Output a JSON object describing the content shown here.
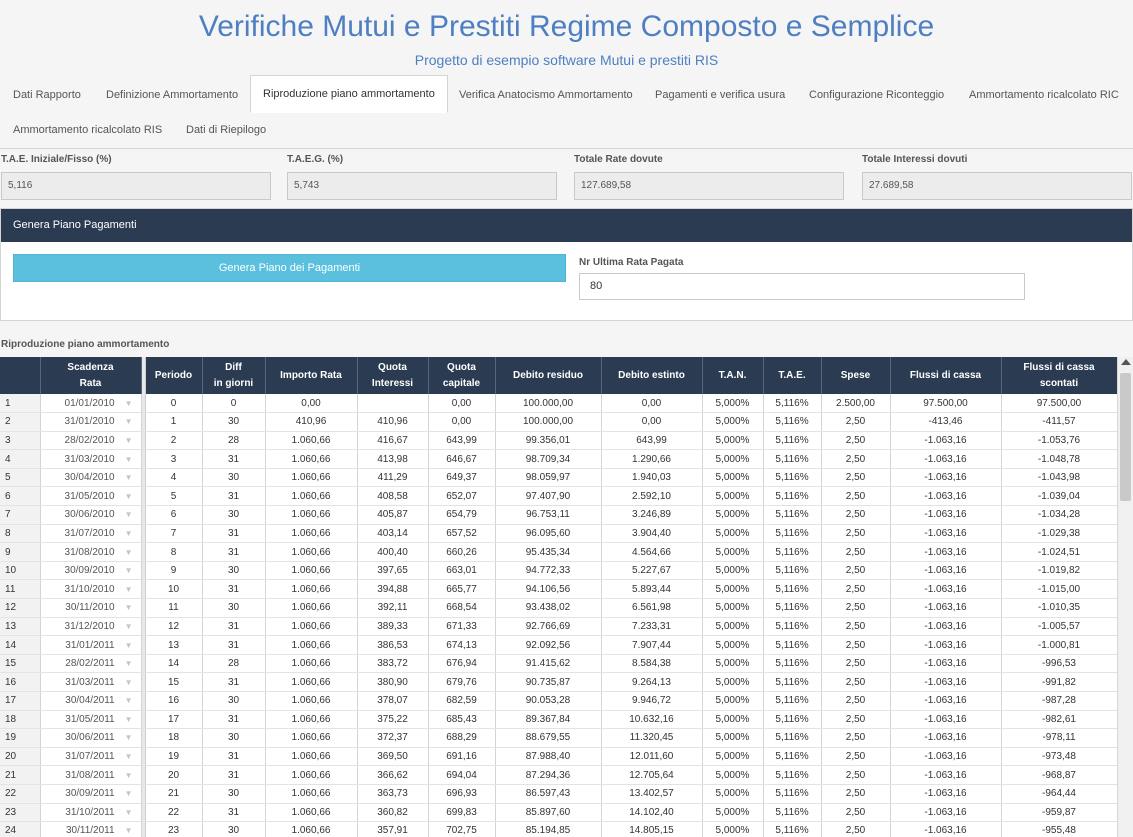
{
  "header": {
    "title": "Verifiche Mutui e Prestiti Regime Composto e Semplice",
    "subtitle": "Progetto di esempio software Mutui e prestiti RIS"
  },
  "tabs": [
    {
      "label": "Dati Rapporto"
    },
    {
      "label": "Definizione Ammortamento"
    },
    {
      "label": "Riproduzione piano ammortamento",
      "active": true
    },
    {
      "label": "Verifica Anatocismo Ammortamento"
    },
    {
      "label": "Pagamenti e verifica usura"
    },
    {
      "label": "Configurazione Riconteggio"
    },
    {
      "label": "Ammortamento ricalcolato RIC"
    },
    {
      "label": "Ammortamento ricalcolato RIS"
    },
    {
      "label": "Dati di Riepilogo"
    }
  ],
  "kpis": [
    {
      "label": "T.A.E. Iniziale/Fisso (%)",
      "value": "5,116"
    },
    {
      "label": "T.A.E.G. (%)",
      "value": "5,743"
    },
    {
      "label": "Totale Rate dovute",
      "value": "127.689,58"
    },
    {
      "label": "Totale Interessi dovuti",
      "value": "27.689,58"
    }
  ],
  "panel": {
    "title": "Genera Piano Pagamenti",
    "button_label": "Genera Piano dei Pagamenti",
    "ultima_label": "Nr Ultima Rata Pagata",
    "ultima_value": "80"
  },
  "grid": {
    "caption": "Riproduzione piano ammortamento",
    "columns": [
      {
        "label": "Scadenza\nRata"
      },
      {
        "label": "Periodo"
      },
      {
        "label": "Diff\nin giorni"
      },
      {
        "label": "Importo Rata"
      },
      {
        "label": "Quota\nInteressi"
      },
      {
        "label": "Quota\ncapitale"
      },
      {
        "label": "Debito residuo"
      },
      {
        "label": "Debito estinto"
      },
      {
        "label": "T.A.N."
      },
      {
        "label": "T.A.E."
      },
      {
        "label": "Spese"
      },
      {
        "label": "Flussi di cassa"
      },
      {
        "label": "Flussi di cassa\nscontati"
      }
    ],
    "rows": [
      {
        "n": "1",
        "scad": "01/01/2010",
        "per": "0",
        "diff": "0",
        "imp": "0,00",
        "qi": "",
        "qc": "0,00",
        "dr": "100.000,00",
        "de": "0,00",
        "tan": "5,000%",
        "tae": "5,116%",
        "spese": "2.500,00",
        "fc": "97.500,00",
        "fcs": "97.500,00"
      },
      {
        "n": "2",
        "scad": "31/01/2010",
        "per": "1",
        "diff": "30",
        "imp": "410,96",
        "qi": "410,96",
        "qc": "0,00",
        "dr": "100.000,00",
        "de": "0,00",
        "tan": "5,000%",
        "tae": "5,116%",
        "spese": "2,50",
        "fc": "-413,46",
        "fcs": "-411,57"
      },
      {
        "n": "3",
        "scad": "28/02/2010",
        "per": "2",
        "diff": "28",
        "imp": "1.060,66",
        "qi": "416,67",
        "qc": "643,99",
        "dr": "99.356,01",
        "de": "643,99",
        "tan": "5,000%",
        "tae": "5,116%",
        "spese": "2,50",
        "fc": "-1.063,16",
        "fcs": "-1.053,76"
      },
      {
        "n": "4",
        "scad": "31/03/2010",
        "per": "3",
        "diff": "31",
        "imp": "1.060,66",
        "qi": "413,98",
        "qc": "646,67",
        "dr": "98.709,34",
        "de": "1.290,66",
        "tan": "5,000%",
        "tae": "5,116%",
        "spese": "2,50",
        "fc": "-1.063,16",
        "fcs": "-1.048,78"
      },
      {
        "n": "5",
        "scad": "30/04/2010",
        "per": "4",
        "diff": "30",
        "imp": "1.060,66",
        "qi": "411,29",
        "qc": "649,37",
        "dr": "98.059,97",
        "de": "1.940,03",
        "tan": "5,000%",
        "tae": "5,116%",
        "spese": "2,50",
        "fc": "-1.063,16",
        "fcs": "-1.043,98"
      },
      {
        "n": "6",
        "scad": "31/05/2010",
        "per": "5",
        "diff": "31",
        "imp": "1.060,66",
        "qi": "408,58",
        "qc": "652,07",
        "dr": "97.407,90",
        "de": "2.592,10",
        "tan": "5,000%",
        "tae": "5,116%",
        "spese": "2,50",
        "fc": "-1.063,16",
        "fcs": "-1.039,04"
      },
      {
        "n": "7",
        "scad": "30/06/2010",
        "per": "6",
        "diff": "30",
        "imp": "1.060,66",
        "qi": "405,87",
        "qc": "654,79",
        "dr": "96.753,11",
        "de": "3.246,89",
        "tan": "5,000%",
        "tae": "5,116%",
        "spese": "2,50",
        "fc": "-1.063,16",
        "fcs": "-1.034,28"
      },
      {
        "n": "8",
        "scad": "31/07/2010",
        "per": "7",
        "diff": "31",
        "imp": "1.060,66",
        "qi": "403,14",
        "qc": "657,52",
        "dr": "96.095,60",
        "de": "3.904,40",
        "tan": "5,000%",
        "tae": "5,116%",
        "spese": "2,50",
        "fc": "-1.063,16",
        "fcs": "-1.029,38"
      },
      {
        "n": "9",
        "scad": "31/08/2010",
        "per": "8",
        "diff": "31",
        "imp": "1.060,66",
        "qi": "400,40",
        "qc": "660,26",
        "dr": "95.435,34",
        "de": "4.564,66",
        "tan": "5,000%",
        "tae": "5,116%",
        "spese": "2,50",
        "fc": "-1.063,16",
        "fcs": "-1.024,51"
      },
      {
        "n": "10",
        "scad": "30/09/2010",
        "per": "9",
        "diff": "30",
        "imp": "1.060,66",
        "qi": "397,65",
        "qc": "663,01",
        "dr": "94.772,33",
        "de": "5.227,67",
        "tan": "5,000%",
        "tae": "5,116%",
        "spese": "2,50",
        "fc": "-1.063,16",
        "fcs": "-1.019,82"
      },
      {
        "n": "11",
        "scad": "31/10/2010",
        "per": "10",
        "diff": "31",
        "imp": "1.060,66",
        "qi": "394,88",
        "qc": "665,77",
        "dr": "94.106,56",
        "de": "5.893,44",
        "tan": "5,000%",
        "tae": "5,116%",
        "spese": "2,50",
        "fc": "-1.063,16",
        "fcs": "-1.015,00"
      },
      {
        "n": "12",
        "scad": "30/11/2010",
        "per": "11",
        "diff": "30",
        "imp": "1.060,66",
        "qi": "392,11",
        "qc": "668,54",
        "dr": "93.438,02",
        "de": "6.561,98",
        "tan": "5,000%",
        "tae": "5,116%",
        "spese": "2,50",
        "fc": "-1.063,16",
        "fcs": "-1.010,35"
      },
      {
        "n": "13",
        "scad": "31/12/2010",
        "per": "12",
        "diff": "31",
        "imp": "1.060,66",
        "qi": "389,33",
        "qc": "671,33",
        "dr": "92.766,69",
        "de": "7.233,31",
        "tan": "5,000%",
        "tae": "5,116%",
        "spese": "2,50",
        "fc": "-1.063,16",
        "fcs": "-1.005,57"
      },
      {
        "n": "14",
        "scad": "31/01/2011",
        "per": "13",
        "diff": "31",
        "imp": "1.060,66",
        "qi": "386,53",
        "qc": "674,13",
        "dr": "92.092,56",
        "de": "7.907,44",
        "tan": "5,000%",
        "tae": "5,116%",
        "spese": "2,50",
        "fc": "-1.063,16",
        "fcs": "-1.000,81"
      },
      {
        "n": "15",
        "scad": "28/02/2011",
        "per": "14",
        "diff": "28",
        "imp": "1.060,66",
        "qi": "383,72",
        "qc": "676,94",
        "dr": "91.415,62",
        "de": "8.584,38",
        "tan": "5,000%",
        "tae": "5,116%",
        "spese": "2,50",
        "fc": "-1.063,16",
        "fcs": "-996,53"
      },
      {
        "n": "16",
        "scad": "31/03/2011",
        "per": "15",
        "diff": "31",
        "imp": "1.060,66",
        "qi": "380,90",
        "qc": "679,76",
        "dr": "90.735,87",
        "de": "9.264,13",
        "tan": "5,000%",
        "tae": "5,116%",
        "spese": "2,50",
        "fc": "-1.063,16",
        "fcs": "-991,82"
      },
      {
        "n": "17",
        "scad": "30/04/2011",
        "per": "16",
        "diff": "30",
        "imp": "1.060,66",
        "qi": "378,07",
        "qc": "682,59",
        "dr": "90.053,28",
        "de": "9.946,72",
        "tan": "5,000%",
        "tae": "5,116%",
        "spese": "2,50",
        "fc": "-1.063,16",
        "fcs": "-987,28"
      },
      {
        "n": "18",
        "scad": "31/05/2011",
        "per": "17",
        "diff": "31",
        "imp": "1.060,66",
        "qi": "375,22",
        "qc": "685,43",
        "dr": "89.367,84",
        "de": "10.632,16",
        "tan": "5,000%",
        "tae": "5,116%",
        "spese": "2,50",
        "fc": "-1.063,16",
        "fcs": "-982,61"
      },
      {
        "n": "19",
        "scad": "30/06/2011",
        "per": "18",
        "diff": "30",
        "imp": "1.060,66",
        "qi": "372,37",
        "qc": "688,29",
        "dr": "88.679,55",
        "de": "11.320,45",
        "tan": "5,000%",
        "tae": "5,116%",
        "spese": "2,50",
        "fc": "-1.063,16",
        "fcs": "-978,11"
      },
      {
        "n": "20",
        "scad": "31/07/2011",
        "per": "19",
        "diff": "31",
        "imp": "1.060,66",
        "qi": "369,50",
        "qc": "691,16",
        "dr": "87.988,40",
        "de": "12.011,60",
        "tan": "5,000%",
        "tae": "5,116%",
        "spese": "2,50",
        "fc": "-1.063,16",
        "fcs": "-973,48"
      },
      {
        "n": "21",
        "scad": "31/08/2011",
        "per": "20",
        "diff": "31",
        "imp": "1.060,66",
        "qi": "366,62",
        "qc": "694,04",
        "dr": "87.294,36",
        "de": "12.705,64",
        "tan": "5,000%",
        "tae": "5,116%",
        "spese": "2,50",
        "fc": "-1.063,16",
        "fcs": "-968,87"
      },
      {
        "n": "22",
        "scad": "30/09/2011",
        "per": "21",
        "diff": "30",
        "imp": "1.060,66",
        "qi": "363,73",
        "qc": "696,93",
        "dr": "86.597,43",
        "de": "13.402,57",
        "tan": "5,000%",
        "tae": "5,116%",
        "spese": "2,50",
        "fc": "-1.063,16",
        "fcs": "-964,44"
      },
      {
        "n": "23",
        "scad": "31/10/2011",
        "per": "22",
        "diff": "31",
        "imp": "1.060,66",
        "qi": "360,82",
        "qc": "699,83",
        "dr": "85.897,60",
        "de": "14.102,40",
        "tan": "5,000%",
        "tae": "5,116%",
        "spese": "2,50",
        "fc": "-1.063,16",
        "fcs": "-959,87"
      },
      {
        "n": "24",
        "scad": "30/11/2011",
        "per": "23",
        "diff": "30",
        "imp": "1.060,66",
        "qi": "357,91",
        "qc": "702,75",
        "dr": "85.194,85",
        "de": "14.805,15",
        "tan": "5,000%",
        "tae": "5,116%",
        "spese": "2,50",
        "fc": "-1.063,16",
        "fcs": "-955,48"
      }
    ]
  }
}
